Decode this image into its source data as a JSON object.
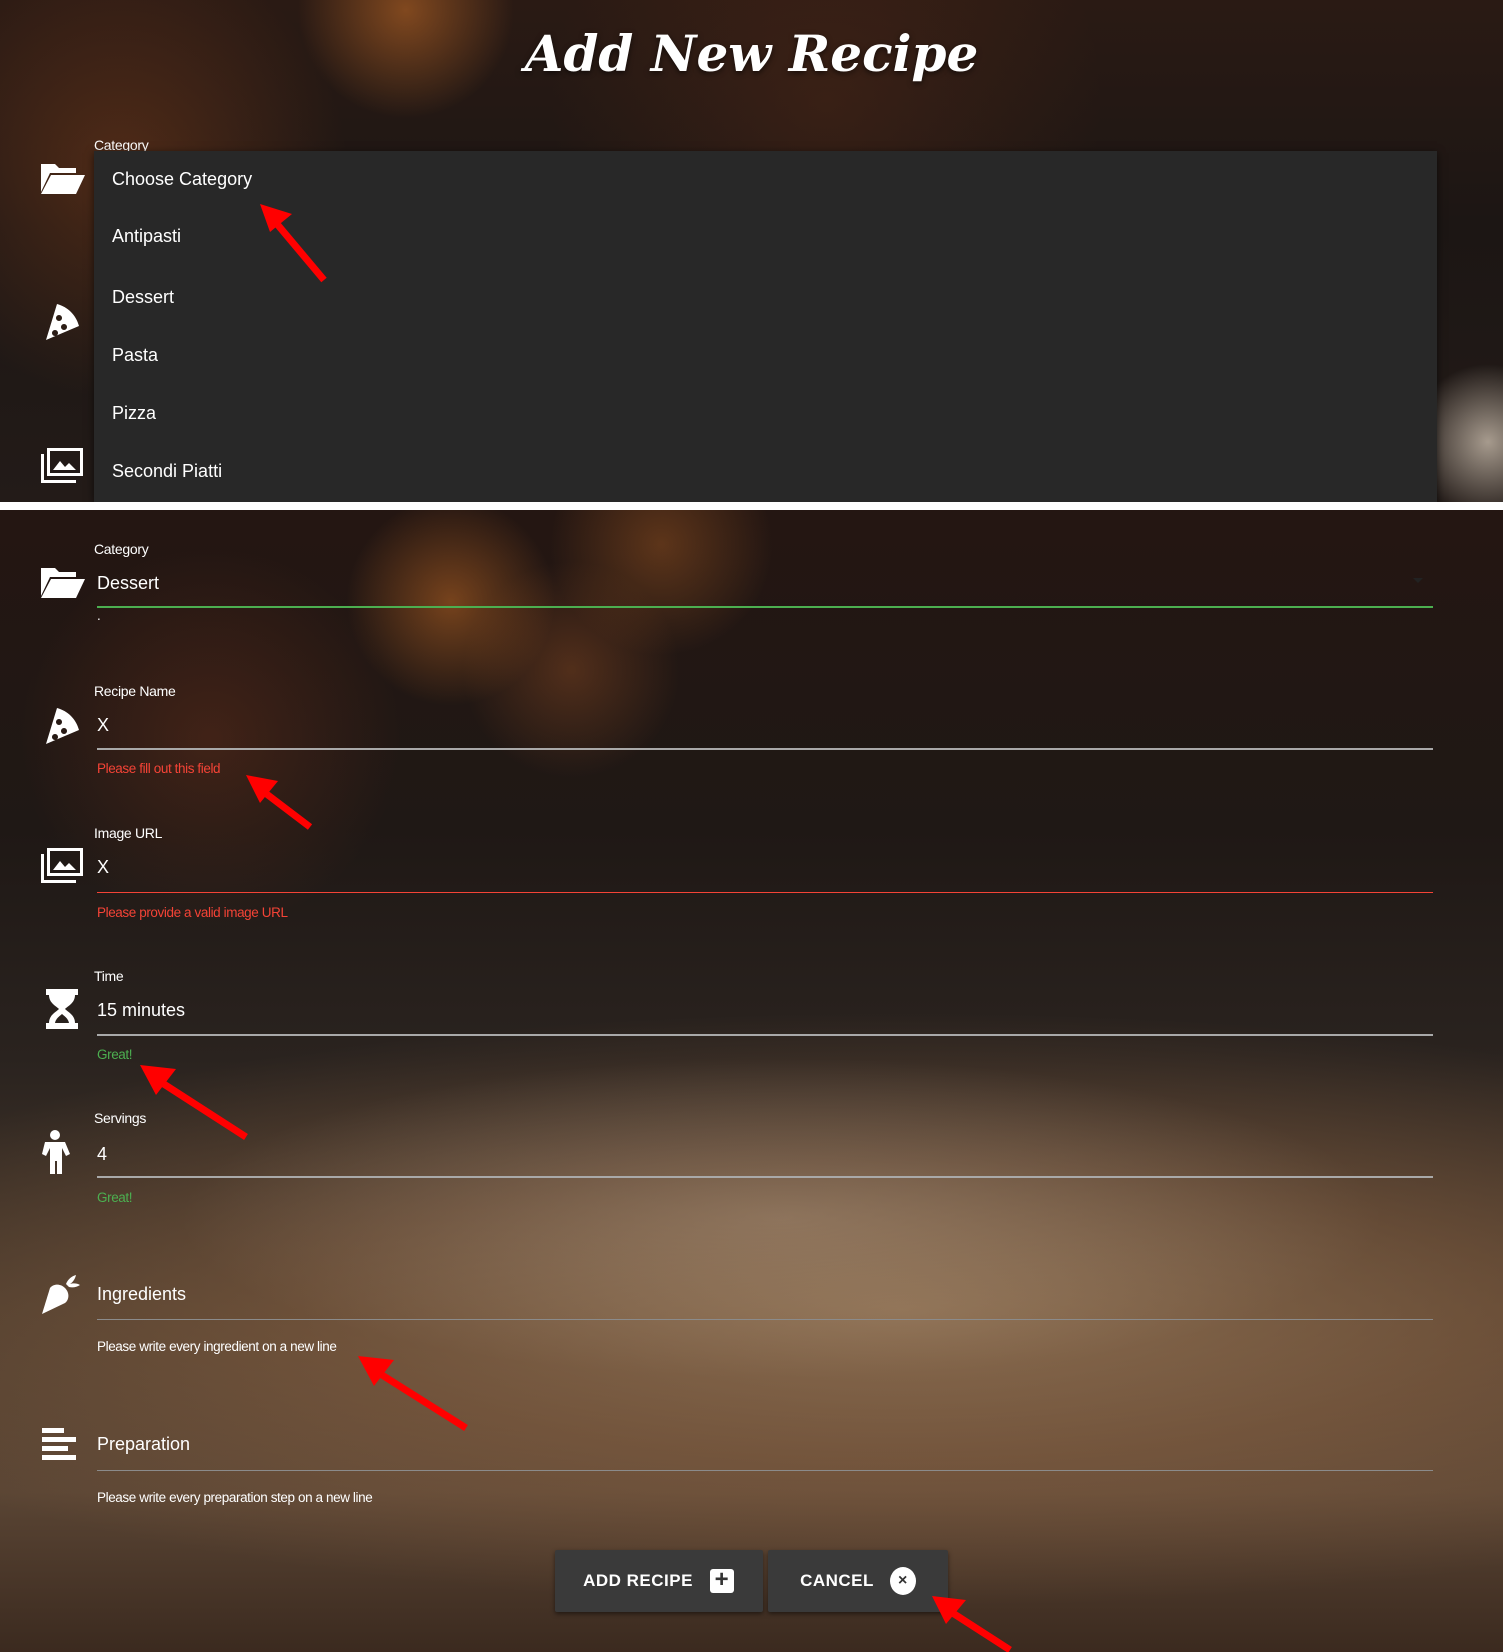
{
  "top": {
    "title": "Add New Recipe",
    "category_label": "Category",
    "dropdown_options": [
      "Choose Category",
      "Antipasti",
      "Dessert",
      "Pasta",
      "Pizza",
      "Secondi Piatti"
    ]
  },
  "form": {
    "category": {
      "label": "Category",
      "value": "Dessert",
      "helper": "."
    },
    "recipe_name": {
      "label": "Recipe Name",
      "value": "X",
      "helper": "Please fill out this field"
    },
    "image_url": {
      "label": "Image URL",
      "value": "X",
      "helper": "Please provide a valid image URL"
    },
    "time": {
      "label": "Time",
      "value": "15 minutes",
      "helper": "Great!"
    },
    "servings": {
      "label": "Servings",
      "value": "4",
      "helper": "Great!"
    },
    "ingredients": {
      "label": "Ingredients",
      "helper": "Please write every ingredient on a new line"
    },
    "preparation": {
      "label": "Preparation",
      "helper": "Please write every preparation step on a new line"
    }
  },
  "buttons": {
    "add": "ADD RECIPE",
    "cancel": "CANCEL"
  },
  "icons": [
    "folder-open-icon",
    "pizza-slice-icon",
    "images-icon",
    "hourglass-icon",
    "child-icon",
    "carrot-icon",
    "align-left-icon"
  ],
  "colors": {
    "error": "#f44336",
    "success": "#4caf50",
    "annotation_arrow": "#ff0000"
  }
}
